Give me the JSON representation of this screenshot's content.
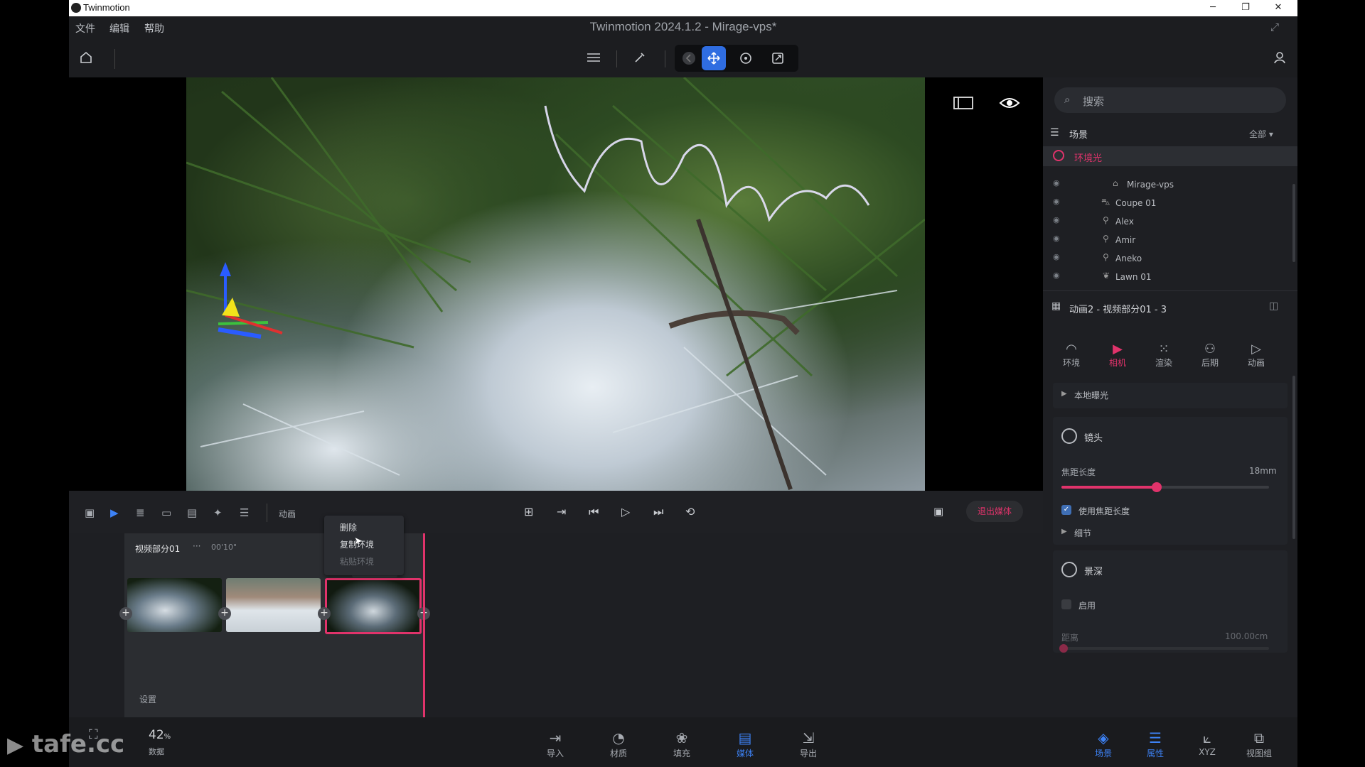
{
  "titlebar": {
    "app": "Twinmotion",
    "minimize": "─",
    "restore": "❐",
    "close": "✕"
  },
  "menu": {
    "file": "文件",
    "edit": "编辑",
    "help": "帮助"
  },
  "app_title": "Twinmotion 2024.1.2 - Mirage-vps*",
  "search": {
    "placeholder": "搜索"
  },
  "scene_panel": {
    "title": "场景",
    "filter": "全部",
    "ambient": "环境光",
    "items": [
      {
        "label": "Mirage-vps",
        "icon": "building-icon"
      },
      {
        "label": "Coupe 01",
        "icon": "car-icon"
      },
      {
        "label": "Alex",
        "icon": "person-icon"
      },
      {
        "label": "Amir",
        "icon": "person-icon"
      },
      {
        "label": "Aneko",
        "icon": "person-icon"
      },
      {
        "label": "Lawn 01",
        "icon": "plant-icon"
      }
    ]
  },
  "properties": {
    "title": "动画2 - 视频部分01 - 3",
    "tabs": [
      {
        "label": "环境",
        "icon": "environment-icon"
      },
      {
        "label": "相机",
        "icon": "camera-icon",
        "active": true
      },
      {
        "label": "渲染",
        "icon": "render-icon"
      },
      {
        "label": "后期",
        "icon": "post-icon"
      },
      {
        "label": "动画",
        "icon": "animation-icon"
      }
    ],
    "local_exposure": "本地曝光",
    "lens": {
      "title": "镜头",
      "focal_label": "焦距长度",
      "focal_value": "18mm",
      "focal_level": 0.46,
      "use_focal": "使用焦距长度",
      "details": "细节"
    },
    "dof": {
      "title": "景深",
      "enable": "启用",
      "distance_label": "距离",
      "distance_value": "100.00cm",
      "distance_level": 0.0
    }
  },
  "timeline": {
    "animation_label": "动画",
    "exit_media": "退出媒体",
    "segment_title": "视频部分01",
    "segment_more": "···",
    "segment_time": "00'10\"",
    "settings": "设置",
    "clip_more": "···",
    "context_menu": [
      "删除",
      "复制环境",
      "粘贴环境"
    ]
  },
  "bottom": {
    "stats_value": "42",
    "stats_unit": "%",
    "stats_label": "数据",
    "buttons": [
      {
        "label": "导入",
        "icon": "import-icon"
      },
      {
        "label": "材质",
        "icon": "material-icon"
      },
      {
        "label": "填充",
        "icon": "populate-icon"
      },
      {
        "label": "媒体",
        "icon": "media-icon",
        "active": true
      },
      {
        "label": "导出",
        "icon": "export-icon"
      }
    ],
    "right": [
      {
        "label": "场景",
        "icon": "scene-icon",
        "active": true
      },
      {
        "label": "属性",
        "icon": "properties-icon",
        "active": true
      },
      {
        "label": "XYZ",
        "icon": "xyz-icon"
      },
      {
        "label": "视图组",
        "icon": "viewgroup-icon"
      }
    ]
  },
  "watermark": "tafe.cc",
  "colors": {
    "accent": "#e0336b",
    "blue": "#2f6de1",
    "bg": "#1c1d20"
  }
}
